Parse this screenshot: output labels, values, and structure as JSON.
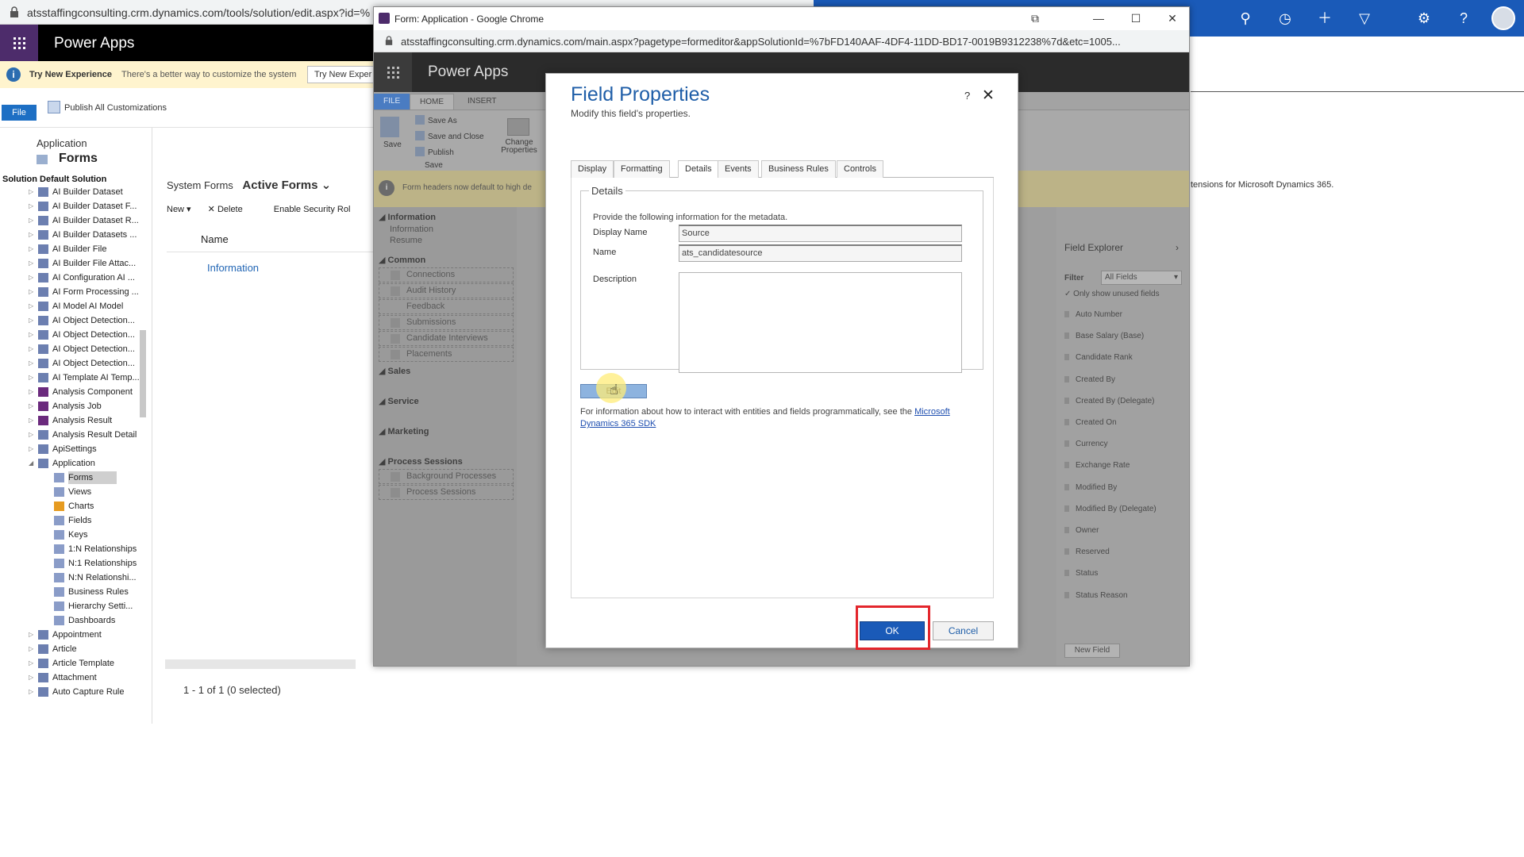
{
  "bg_window": {
    "url": "atsstaffingconsulting.crm.dynamics.com/tools/solution/edit.aspx?id=%",
    "app_name": "Power Apps",
    "tip": {
      "title": "Try New Experience",
      "text": "There's a better way to customize the system",
      "button": "Try New Exper"
    },
    "file_button": "File",
    "publish_all": "Publish All Customizations",
    "entity": "Application",
    "section_title": "Forms",
    "solution": "Solution Default Solution",
    "tree": [
      "AI Builder Dataset",
      "AI Builder Dataset F...",
      "AI Builder Dataset R...",
      "AI Builder Datasets ...",
      "AI Builder File",
      "AI Builder File Attac...",
      "AI Configuration AI ...",
      "AI Form Processing ...",
      "AI Model AI Model",
      "AI Object Detection...",
      "AI Object Detection...",
      "AI Object Detection...",
      "AI Object Detection...",
      "AI Template AI Temp...",
      "Analysis Component",
      "Analysis Job",
      "Analysis Result",
      "Analysis Result Detail",
      "ApiSettings",
      "Application"
    ],
    "tree_children": [
      "Forms",
      "Views",
      "Charts",
      "Fields",
      "Keys",
      "1:N Relationships",
      "N:1 Relationships",
      "N:N Relationshi...",
      "Business Rules",
      "Hierarchy Setti...",
      "Dashboards"
    ],
    "tree_after": [
      "Appointment",
      "Article",
      "Article Template",
      "Attachment",
      "Auto Capture Rule"
    ],
    "crumb_prefix": "System Forms",
    "crumb_view": "Active Forms ⌄",
    "toolbar": {
      "new": "New ▾",
      "delete": "Delete",
      "security": "Enable Security Rol"
    },
    "col_name": "Name",
    "row_name": "Information",
    "footer": "1 - 1 of 1 (0 selected)"
  },
  "bg_right": {
    "ext_text": "tensions for Microsoft Dynamics 365."
  },
  "popup": {
    "title": "Form: Application - Google Chrome",
    "url": "atsstaffingconsulting.crm.dynamics.com/main.aspx?pagetype=formeditor&appSolutionId=%7bFD140AAF-4DF4-11DD-BD17-0019B9312238%7d&etc=1005...",
    "app_name": "Power Apps",
    "ribbon_tabs": {
      "file": "FILE",
      "home": "HOME",
      "insert": "INSERT"
    },
    "ribbon": {
      "save": "Save",
      "save_as": "Save As",
      "save_close": "Save and Close",
      "publish": "Publish",
      "group_save": "Save",
      "change_props": "Change Properties"
    },
    "notification": "Form headers now default to high de",
    "left_nav": {
      "information": "Information",
      "information_sub": "Information",
      "resume": "Resume",
      "common": "Common",
      "connections": "Connections",
      "audit_history": "Audit History",
      "feedback": "Feedback",
      "submissions": "Submissions",
      "candidate_interviews": "Candidate Interviews",
      "placements": "Placements",
      "sales": "Sales",
      "service": "Service",
      "marketing": "Marketing",
      "process_sessions": "Process Sessions",
      "background_processes": "Background Processes",
      "process_sessions_item": "Process Sessions"
    },
    "field_explorer": {
      "title": "Field Explorer",
      "filter_label": "Filter",
      "filter_value": "All Fields",
      "only_unused": "Only show unused fields",
      "fields": [
        "Auto Number",
        "Base Salary (Base)",
        "Candidate Rank",
        "Created By",
        "Created By (Delegate)",
        "Created On",
        "Currency",
        "Exchange Rate",
        "Modified By",
        "Modified By (Delegate)",
        "Owner",
        "Reserved",
        "Status",
        "Status Reason"
      ],
      "new_field": "New Field"
    }
  },
  "dialog": {
    "title": "Field Properties",
    "subtitle": "Modify this field's properties.",
    "help": "?",
    "close": "✕",
    "tabs": [
      "Display",
      "Formatting",
      "Details",
      "Events",
      "Business Rules",
      "Controls"
    ],
    "legend": "Details",
    "provide": "Provide the following information for the metadata.",
    "display_name_label": "Display Name",
    "display_name_value": "Source",
    "name_label": "Name",
    "name_value": "ats_candidatesource",
    "description_label": "Description",
    "edit_button": "Edit",
    "info_text": "For information about how to interact with entities and fields programmatically, see the ",
    "info_link": "Microsoft Dynamics 365 SDK",
    "ok": "OK",
    "cancel": "Cancel"
  }
}
